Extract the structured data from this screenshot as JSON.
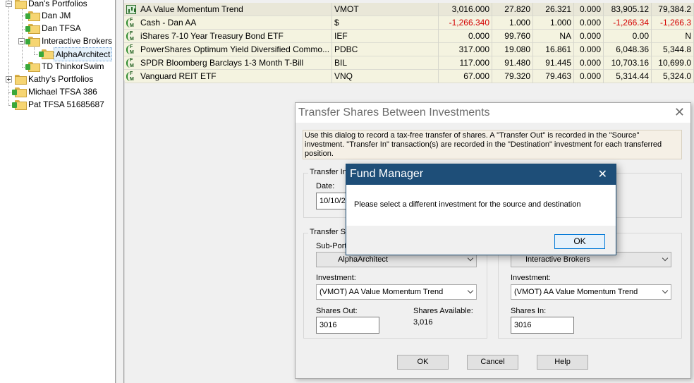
{
  "tree": {
    "items": [
      {
        "label": "Dan's Portfolios"
      },
      {
        "label": "Dan JM"
      },
      {
        "label": "Dan TFSA"
      },
      {
        "label": "Interactive Brokers"
      },
      {
        "label": "AlphaArchitect"
      },
      {
        "label": "TD ThinkorSwim"
      },
      {
        "label": "Kathy's Portfolios"
      },
      {
        "label": "Michael TFSA 386"
      },
      {
        "label": "Pat TFSA 51685687"
      }
    ]
  },
  "grid": {
    "rows": [
      {
        "name": "AA Value Momentum Trend",
        "symbol": "VMOT",
        "shares": "3,016.000",
        "price": "27.820",
        "cost": "26.321",
        "c4": "0.000",
        "value": "83,905.12",
        "c6": "79,384.2",
        "neg": false,
        "icon": "bars"
      },
      {
        "name": "Cash - Dan AA",
        "symbol": "$",
        "shares": "-1,266.340",
        "price": "1.000",
        "cost": "1.000",
        "c4": "0.000",
        "value": "-1,266.34",
        "c6": "-1,266.3",
        "neg": true,
        "icon": "fm"
      },
      {
        "name": "iShares 7-10 Year Treasury Bond ETF",
        "symbol": "IEF",
        "shares": "0.000",
        "price": "99.760",
        "cost": "NA",
        "c4": "0.000",
        "value": "0.00",
        "c6": "N",
        "neg": false,
        "icon": "fm"
      },
      {
        "name": "PowerShares Optimum Yield Diversified Commo...",
        "symbol": "PDBC",
        "shares": "317.000",
        "price": "19.080",
        "cost": "16.861",
        "c4": "0.000",
        "value": "6,048.36",
        "c6": "5,344.8",
        "neg": false,
        "icon": "fm"
      },
      {
        "name": "SPDR Bloomberg Barclays 1-3 Month T-Bill",
        "symbol": "BIL",
        "shares": "117.000",
        "price": "91.480",
        "cost": "91.445",
        "c4": "0.000",
        "value": "10,703.16",
        "c6": "10,699.0",
        "neg": false,
        "icon": "fm"
      },
      {
        "name": "Vanguard REIT ETF",
        "symbol": "VNQ",
        "shares": "67.000",
        "price": "79.320",
        "cost": "79.463",
        "c4": "0.000",
        "value": "5,314.44",
        "c6": "5,324.0",
        "neg": false,
        "icon": "fm"
      }
    ]
  },
  "transfer_dialog": {
    "title": "Transfer Shares Between Investments",
    "info": "Use this dialog to record a tax-free transfer of shares.  A \"Transfer Out\" is recorded in the \"Source\" investment.  \"Transfer In\" transaction(s) are recorded in the \"Destination\" investment for each transferred position.",
    "info_group_label": "Transfer In",
    "date_label": "Date:",
    "date_value": "10/10/20",
    "source_group_label": "Transfer Sc",
    "sub_portfolio_label": "Sub-Port",
    "source_subportfolio": "AlphaArchitect",
    "source_investment_label": "Investment:",
    "source_investment": "(VMOT) AA Value Momentum Trend",
    "shares_out_label": "Shares Out:",
    "shares_out": "3016",
    "shares_available_label": "Shares Available:",
    "shares_available": "3,016",
    "dest_subportfolio": "Interactive Brokers",
    "dest_investment_label": "Investment:",
    "dest_investment": "(VMOT) AA Value Momentum Trend",
    "shares_in_label": "Shares In:",
    "shares_in": "3016",
    "ok": "OK",
    "cancel": "Cancel",
    "help": "Help",
    "close": "✕"
  },
  "modal": {
    "title": "Fund Manager",
    "message": "Please select a different investment for the source and destination",
    "ok": "OK",
    "close": "✕"
  }
}
